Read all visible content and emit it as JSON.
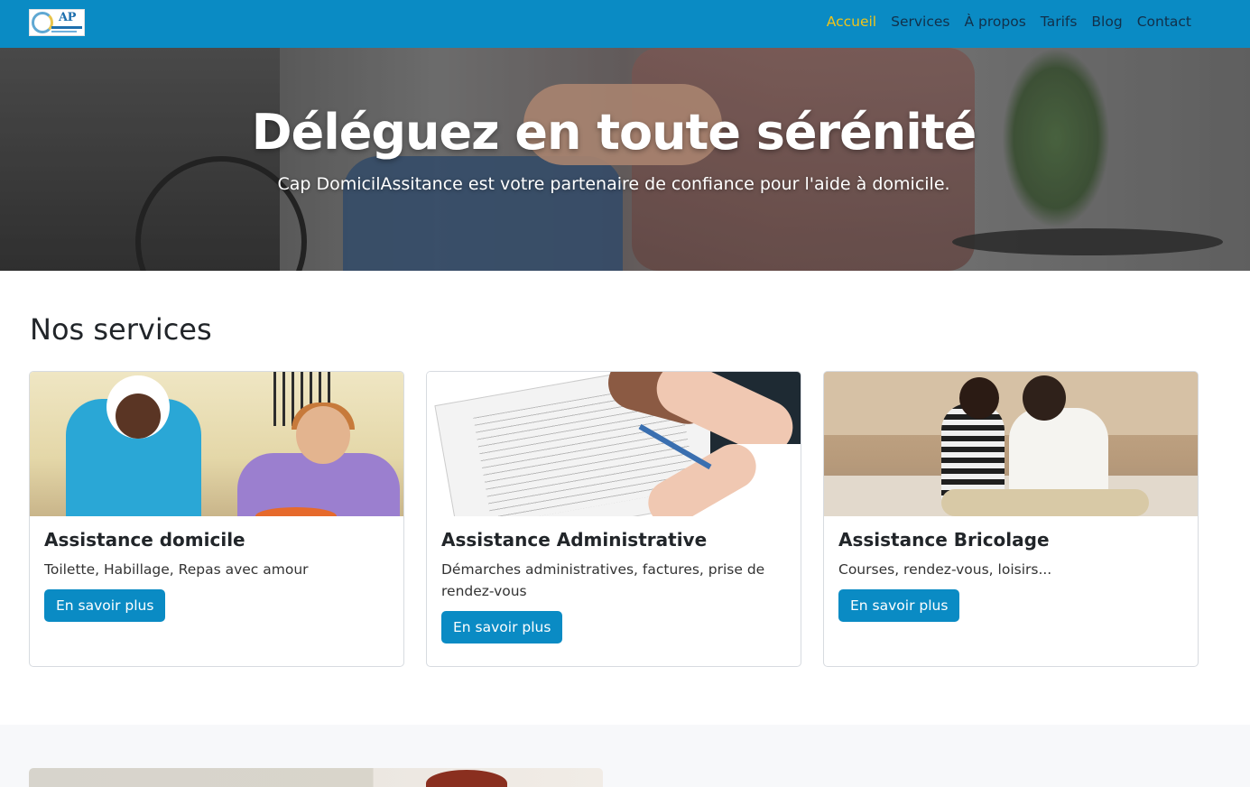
{
  "navbar": {
    "logo_text": "AP",
    "links": [
      {
        "label": "Accueil",
        "active": true
      },
      {
        "label": "Services",
        "active": false
      },
      {
        "label": "À propos",
        "active": false
      },
      {
        "label": "Tarifs",
        "active": false
      },
      {
        "label": "Blog",
        "active": false
      },
      {
        "label": "Contact",
        "active": false
      }
    ]
  },
  "hero": {
    "title": "Déléguez en toute sérénité",
    "subtitle": "Cap DomicilAssitance est votre partenaire de confiance pour l'aide à domicile."
  },
  "services": {
    "heading": "Nos services",
    "cards": [
      {
        "title": "Assistance domicile",
        "text": "Toilette, Habillage, Repas avec amour",
        "button": "En savoir plus"
      },
      {
        "title": "Assistance Administrative",
        "text": "Démarches administratives, factures, prise de rendez-vous",
        "button": "En savoir plus"
      },
      {
        "title": "Assistance Bricolage",
        "text": "Courses, rendez-vous, loisirs...",
        "button": "En savoir plus"
      }
    ]
  },
  "colors": {
    "primary": "#0a8bc4",
    "active_link": "#f0c419",
    "nav_text": "#12304a"
  }
}
